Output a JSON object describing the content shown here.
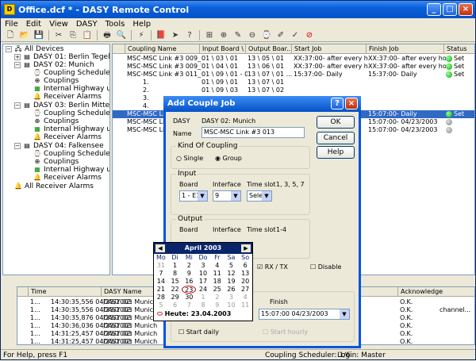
{
  "title": "Office.dcf * - DASY Remote Control",
  "menu": [
    "File",
    "Edit",
    "View",
    "DASY",
    "Tools",
    "Help"
  ],
  "tree": [
    "All Devices",
    "DASY 01: Berlin Tegel",
    "DASY 02: Munich",
    "Coupling Scheduler",
    "Couplings",
    "Internal Highway usage",
    "Receiver Alarms",
    "DASY 03: Berlin Mitte",
    "Coupling Scheduler",
    "Couplings",
    "Internal Highway usage",
    "Receiver Alarms",
    "DASY 04: Falkensee",
    "Coupling Scheduler",
    "Couplings",
    "Internal Highway usage",
    "Receiver Alarms",
    "All Receiver Alarms"
  ],
  "columns": [
    "Coupling Name",
    "Input Board \\ ...",
    "Output Boar...",
    "Start Job",
    "Finish Job",
    "Status"
  ],
  "rows": [
    [
      "MSC-MSC Link #3 009_RX",
      "01 \\ 03 \\ 01",
      "13 \\ 05 \\ 01",
      "XX:37:00- after every hour",
      "XX:37:00- after every hour",
      "Set",
      "g"
    ],
    [
      "MSC-MSC Link #3 009_TX",
      "01 \\ 04 \\ 01",
      "13 \\ 06 \\ 01",
      "XX:37:00- after every hour",
      "XX:37:00- after every hour",
      "Set",
      "g"
    ],
    [
      "MSC-MSC Link #3 011_RX",
      "01 \\ 09 \\ 01 - 07",
      "13 \\ 07 \\ 01 ...",
      "15:37:00- Daily",
      "15:37:00- Daily",
      "Set",
      "g"
    ],
    [
      "1.",
      "01 \\ 09 \\ 01",
      "13 \\ 07 \\ 01",
      "",
      "",
      "",
      ""
    ],
    [
      "2.",
      "01 \\ 09 \\ 03",
      "13 \\ 07 \\ 02",
      "",
      "",
      "",
      ""
    ],
    [
      "3.",
      "",
      "",
      "",
      "",
      "",
      ""
    ],
    [
      "4.",
      "",
      "",
      "",
      "",
      "",
      ""
    ],
    [
      "MSC-MSC Link",
      "",
      "",
      "",
      "15:07:00- Daily",
      "Set",
      "g"
    ],
    [
      "MSC-MSC Link",
      "",
      "",
      "",
      "15:07:00- 04/23/2003",
      "",
      "gy"
    ],
    [
      "MSC-MSC Link",
      "",
      "",
      "",
      "15:07:00- 04/23/2003",
      "",
      "gy"
    ]
  ],
  "log": {
    "columns": [
      "Time",
      "DASY Name",
      "Acknowledge"
    ],
    "rows": [
      [
        "1...",
        "14:30:35,556 04/23/2003",
        "DASY 02: Munich",
        "009_TX",
        "O.K.",
        ""
      ],
      [
        "1...",
        "14:30:35,556 04/23/2003",
        "DASY 02: Munich",
        "009_RX",
        "O.K.",
        "channel..."
      ],
      [
        "1...",
        "14:30:35,876 04/23/2003",
        "DASY 02: Munich",
        "009_RX",
        "O.K.",
        ""
      ],
      [
        "1...",
        "14:30:36,036 04/23/2003",
        "DASY 02: Munich",
        "009_TX",
        "O.K.",
        ""
      ],
      [
        "1...",
        "14:31:25,457 04/23/2003",
        "DASY 02: Munich",
        "009_RX",
        "O.K.",
        ""
      ],
      [
        "1...",
        "14:31:25,457 04/23/2003",
        "DASY 02: Munich",
        "009_TX",
        "O.K.",
        ""
      ]
    ]
  },
  "status": {
    "left": "For Help, press F1",
    "mid": "Coupling Scheduler: 1/6",
    "right": "Login: Master"
  },
  "dialog": {
    "title": "Add Couple Job",
    "dasy_label": "DASY",
    "dasy_value": "DASY 02: Munich",
    "name_label": "Name",
    "name_value": "MSC-MSC Link #3 013",
    "ok": "OK",
    "cancel": "Cancel",
    "help": "Help",
    "kind": "Kind Of Coupling",
    "single": "Single",
    "group": "Group",
    "input": "Input",
    "board": "Board",
    "interface": "Interface",
    "timeslot": "Time slot",
    "in_board": "1 - E1",
    "in_iface": "9",
    "in_ts": "Select",
    "in_ts_val": "1, 3, 5, 7",
    "output": "Output",
    "out_ts_val": "1-4",
    "rxtx": "RX / TX",
    "disable": "Disable",
    "finish": "Finish",
    "finish_val": "15:07:00  04/23/2003",
    "start_daily": "Start daily",
    "start_hourly": "Start hourly"
  },
  "calendar": {
    "month": "April 2003",
    "days": [
      "Mo",
      "Di",
      "Mi",
      "Do",
      "Fr",
      "Sa",
      "So"
    ],
    "weeks": [
      [
        "31",
        "1",
        "2",
        "3",
        "4",
        "5",
        "6"
      ],
      [
        "7",
        "8",
        "9",
        "10",
        "11",
        "12",
        "13"
      ],
      [
        "14",
        "15",
        "16",
        "17",
        "18",
        "19",
        "20"
      ],
      [
        "21",
        "22",
        "23",
        "24",
        "25",
        "26",
        "27"
      ],
      [
        "28",
        "29",
        "30",
        "1",
        "2",
        "3",
        "4"
      ],
      [
        "5",
        "6",
        "7",
        "8",
        "9",
        "10",
        "11"
      ]
    ],
    "today": "Heute: 23.04.2003"
  }
}
